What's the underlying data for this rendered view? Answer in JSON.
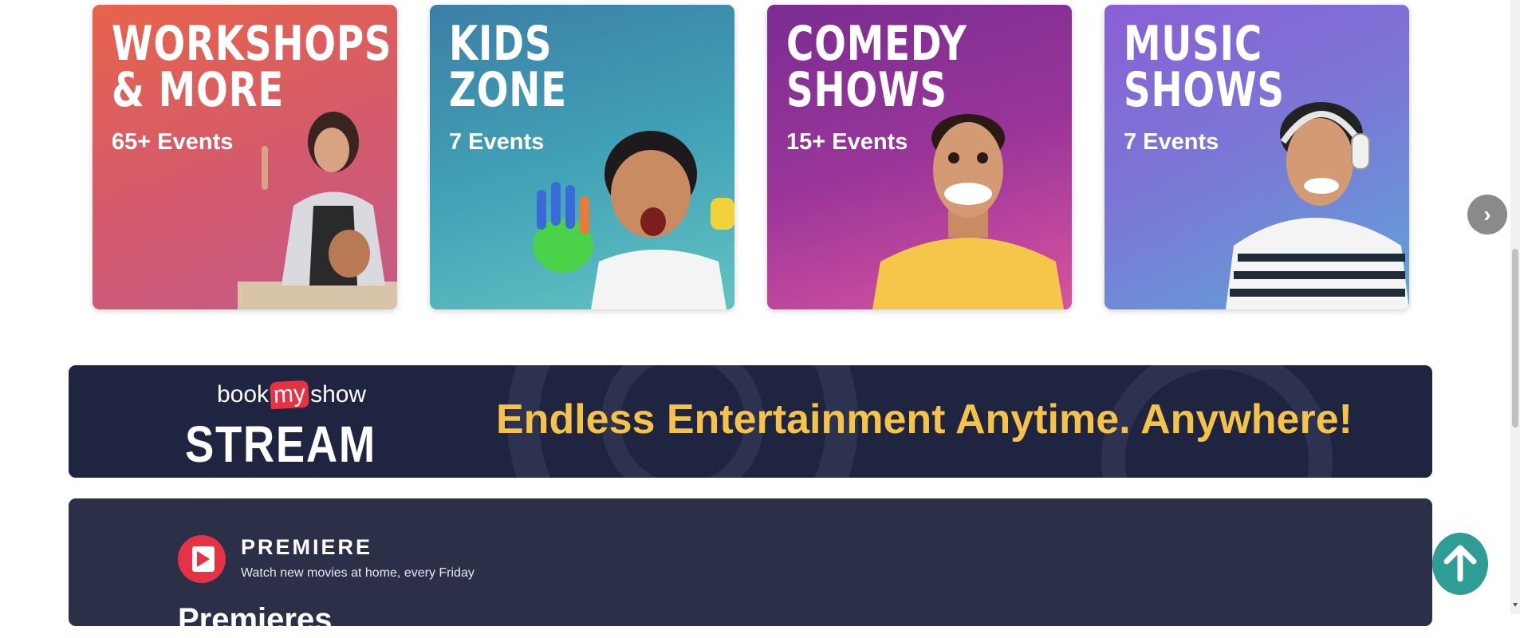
{
  "categories": [
    {
      "title": "Workshops\n& More",
      "count": "65+ Events"
    },
    {
      "title": "Kids\nZone",
      "count": "7 Events"
    },
    {
      "title": "Comedy\nShows",
      "count": "15+ Events"
    },
    {
      "title": "Music\nShows",
      "count": "7 Events"
    }
  ],
  "carousel": {
    "next_label": "›"
  },
  "stream_banner": {
    "brand_book": "book",
    "brand_my": "my",
    "brand_show": "show",
    "brand_stream": "STREAM",
    "tagline": "Endless Entertainment Anytime. Anywhere!"
  },
  "premiere": {
    "title": "PREMIERE",
    "subtitle": "Watch new movies at home, every Friday",
    "next_heading": "Premieres"
  },
  "colors": {
    "brand_red": "#e53345",
    "stream_yellow": "#f5c24a",
    "navy": "#1f2440",
    "teal": "#2f9c95"
  }
}
